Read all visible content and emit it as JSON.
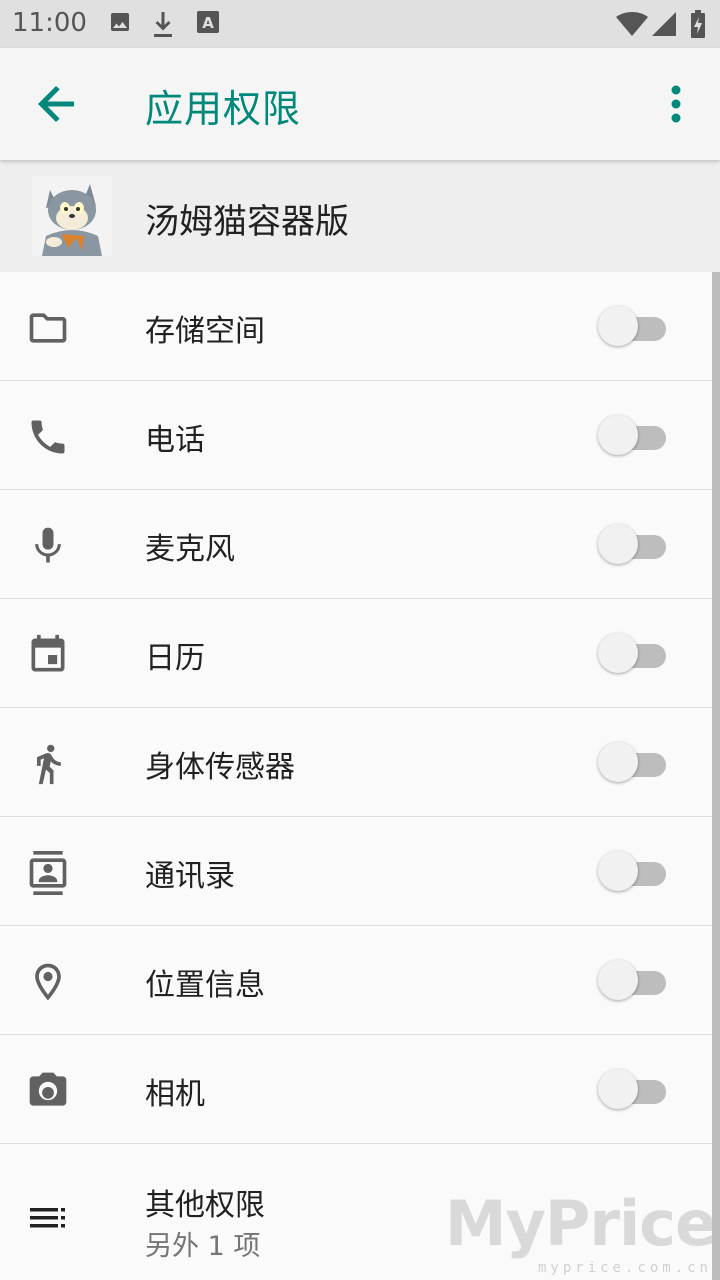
{
  "status_bar": {
    "time": "11:00",
    "left_icons": [
      "image-icon",
      "download-icon",
      "text-a-icon"
    ],
    "right_icons": [
      "wifi-icon",
      "signal-icon",
      "battery-charging-icon"
    ]
  },
  "toolbar": {
    "title": "应用权限",
    "accent_color": "#00897b",
    "back_icon": "arrow-back-icon",
    "menu_icon": "more-vert-icon"
  },
  "app": {
    "name": "汤姆猫容器版",
    "icon": "tom-cat-app-icon"
  },
  "permissions": [
    {
      "label": "存储空间",
      "icon": "folder-icon",
      "enabled": false
    },
    {
      "label": "电话",
      "icon": "phone-icon",
      "enabled": false
    },
    {
      "label": "麦克风",
      "icon": "mic-icon",
      "enabled": false
    },
    {
      "label": "日历",
      "icon": "calendar-icon",
      "enabled": false
    },
    {
      "label": "身体传感器",
      "icon": "walk-icon",
      "enabled": false
    },
    {
      "label": "通讯录",
      "icon": "contacts-icon",
      "enabled": false
    },
    {
      "label": "位置信息",
      "icon": "location-icon",
      "enabled": false
    },
    {
      "label": "相机",
      "icon": "camera-icon",
      "enabled": false
    }
  ],
  "more_permissions": {
    "label": "其他权限",
    "sublabel": "另外 1 项",
    "icon": "list-icon"
  },
  "watermark": {
    "text": "MyPrice",
    "sub": "myprice.com.cn"
  }
}
